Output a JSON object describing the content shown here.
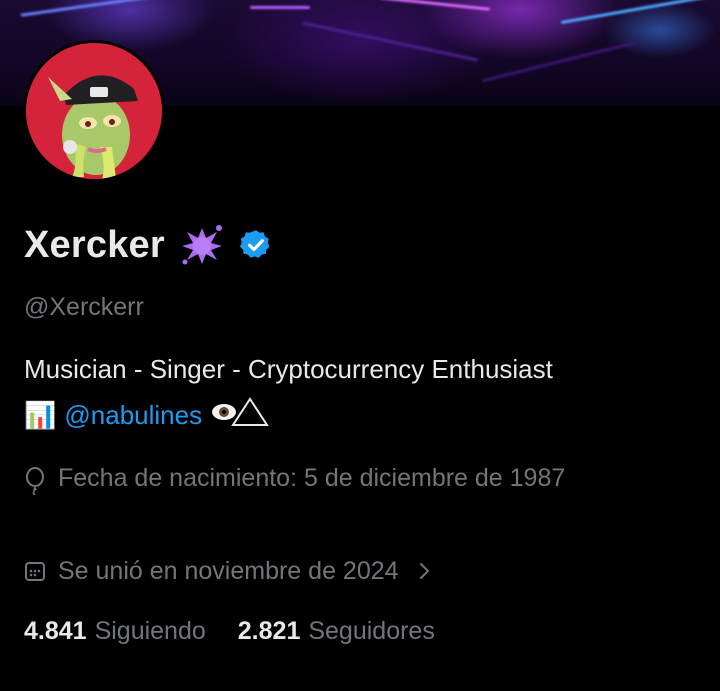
{
  "profile": {
    "name": "Xercker",
    "handle": "@Xerckerr",
    "bio_line1": "Musician - Singer - Cryptocurrency Enthusiast",
    "bio_line2_emoji": "📊",
    "bio_mention": "@nabulines",
    "bio_trailing": "👁️⚠",
    "birth_label": "Fecha de nacimiento: 5 de diciembre de 1987",
    "joined_label": "Se unió en noviembre de 2024",
    "following_count": "4.841",
    "following_label": "Siguiendo",
    "followers_count": "2.821",
    "followers_label": "Seguidores"
  },
  "colors": {
    "background": "#000000",
    "text_primary": "#e7e9ea",
    "text_secondary": "#71767b",
    "link": "#1d9bf0",
    "verified": "#1d9bf0"
  }
}
